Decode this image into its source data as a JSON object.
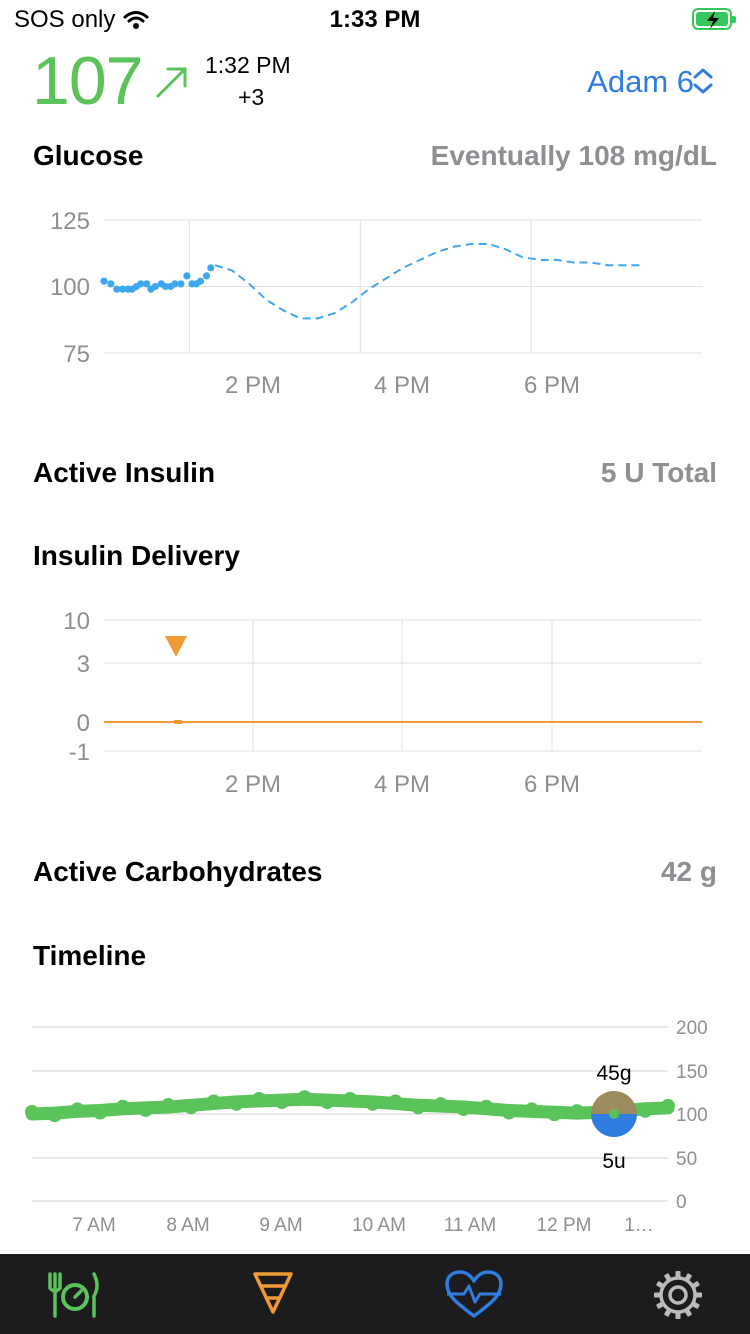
{
  "status_bar": {
    "carrier": "SOS only",
    "time": "1:33 PM",
    "battery": "charging"
  },
  "header": {
    "glucose_value": "107",
    "trend": "rising",
    "reading_time": "1:32 PM",
    "delta": "+3",
    "profile_name": "Adam 6",
    "colors": {
      "glucose": "#5ac35a",
      "profile": "#2f7de1"
    }
  },
  "glucose_section": {
    "title": "Glucose",
    "eventual": "Eventually 108 mg/dL",
    "chart_data": {
      "type": "scatter",
      "y_ticks": [
        "125",
        "100",
        "75"
      ],
      "x_ticks": [
        "2 PM",
        "4 PM",
        "6 PM"
      ],
      "ylim": [
        75,
        125
      ],
      "xlim": [
        13.0,
        20.0
      ],
      "series": [
        {
          "kind": "measured",
          "color": "#3ea7ef",
          "x": [
            13.0,
            13.08,
            13.15,
            13.22,
            13.28,
            13.33,
            13.38,
            13.43,
            13.5,
            13.55,
            13.6,
            13.67,
            13.72,
            13.78,
            13.83,
            13.9,
            13.97,
            14.03,
            14.08,
            14.13,
            14.2,
            14.25
          ],
          "y": [
            102,
            101,
            99,
            99,
            99,
            99,
            100,
            101,
            101,
            99,
            100,
            101,
            100,
            100,
            101,
            101,
            104,
            101,
            101,
            102,
            104,
            107
          ]
        },
        {
          "kind": "predicted",
          "color": "#3ea7ef",
          "x": [
            14.3,
            14.5,
            14.7,
            14.9,
            15.1,
            15.3,
            15.5,
            15.7,
            15.9,
            16.1,
            16.3,
            16.5,
            16.7,
            16.9,
            17.1,
            17.3,
            17.5,
            17.7,
            17.9,
            18.1,
            18.3,
            18.5,
            18.7,
            18.9,
            19.1,
            19.3
          ],
          "y": [
            108,
            106,
            101,
            95,
            91,
            88,
            88,
            90,
            94,
            99,
            103,
            107,
            110,
            113,
            115,
            116,
            116,
            114,
            111,
            110,
            110,
            109,
            109,
            108,
            108,
            108
          ]
        }
      ]
    }
  },
  "active_insulin": {
    "title": "Active Insulin",
    "value": "5 U Total"
  },
  "insulin_section": {
    "title": "Insulin Delivery",
    "chart_data": {
      "type": "line",
      "y_ticks": [
        "10",
        "3",
        "0",
        "-1"
      ],
      "x_ticks": [
        "2 PM",
        "4 PM",
        "6 PM"
      ],
      "basal_rate": 0,
      "bolus_marker_time": "1:30 PM",
      "color": "#f09a36"
    }
  },
  "active_carbs": {
    "title": "Active Carbohydrates",
    "value": "42 g"
  },
  "timeline_section": {
    "title": "Timeline",
    "chart_data": {
      "type": "line",
      "y_ticks": [
        "200",
        "150",
        "100",
        "50",
        "0"
      ],
      "x_ticks": [
        "7 AM",
        "8 AM",
        "9 AM",
        "10 AM",
        "11 AM",
        "12 PM",
        "1…"
      ],
      "ylim": [
        0,
        200
      ],
      "series": [
        {
          "name": "glucose",
          "color": "#5ac35a",
          "x": [
            6.5,
            6.75,
            7.0,
            7.25,
            7.5,
            7.75,
            8.0,
            8.25,
            8.5,
            8.75,
            9.0,
            9.25,
            9.5,
            9.75,
            10.0,
            10.25,
            10.5,
            10.75,
            11.0,
            11.25,
            11.5,
            11.75,
            12.0,
            12.25,
            12.5,
            12.75,
            13.0,
            13.25,
            13.5
          ],
          "y": [
            100,
            101,
            103,
            104,
            106,
            107,
            108,
            110,
            112,
            114,
            115,
            116,
            117,
            116,
            115,
            114,
            112,
            110,
            109,
            108,
            106,
            104,
            103,
            102,
            101,
            102,
            104,
            106,
            107
          ]
        }
      ],
      "event": {
        "carbs_label": "45g",
        "insulin_label": "5u",
        "carb_color": "#9b8b5e",
        "insulin_color": "#2f7de1"
      }
    }
  },
  "tab_bar": {
    "tabs": [
      {
        "name": "carbs",
        "icon": "fork-knife-timer-icon",
        "color": "#5ac35a"
      },
      {
        "name": "bolus",
        "icon": "bolus-triangle-icon",
        "color": "#f09a36"
      },
      {
        "name": "health",
        "icon": "heart-pulse-icon",
        "color": "#2f7de1"
      },
      {
        "name": "settings",
        "icon": "gear-icon",
        "color": "#bbbbbb"
      }
    ]
  }
}
